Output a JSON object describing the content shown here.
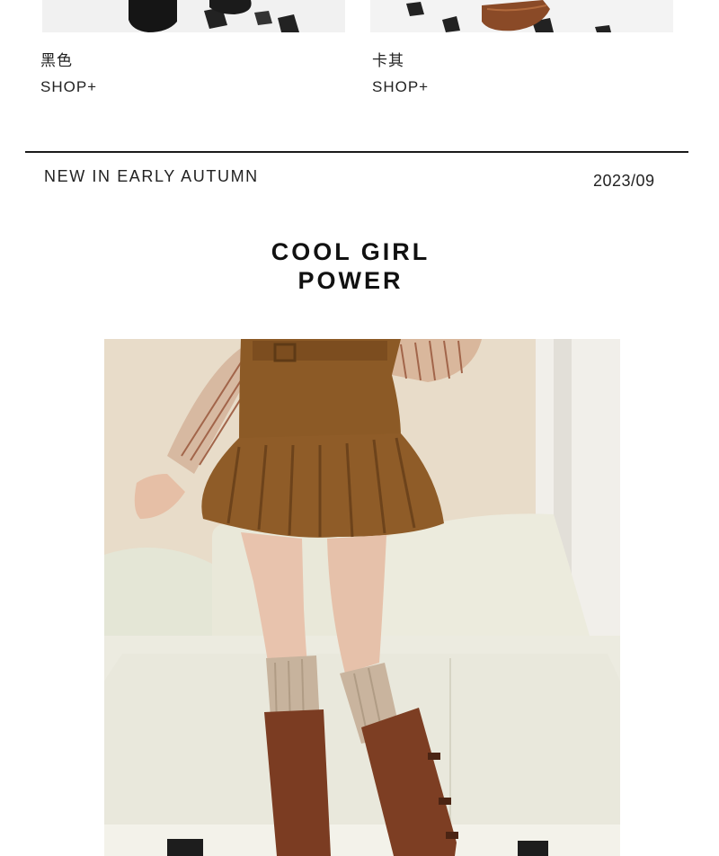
{
  "products": [
    {
      "color_name": "黑色",
      "shop_label": "SHOP+",
      "image_icon": "black-shoe-image"
    },
    {
      "color_name": "卡其",
      "shop_label": "SHOP+",
      "image_icon": "khaki-shoe-image"
    }
  ],
  "section": {
    "tag": "NEW IN EARLY AUTUMN",
    "date": "2023/09"
  },
  "headline": {
    "line1": "COOL  GIRL",
    "line2": "POWER"
  },
  "photo": {
    "icon": "model-skirt-photo"
  },
  "colors": {
    "text": "#222222",
    "divider": "#1a1a1a",
    "skirt": "#8a5a25",
    "boots": "#7a3e22",
    "sofa": "#ece9dc"
  }
}
